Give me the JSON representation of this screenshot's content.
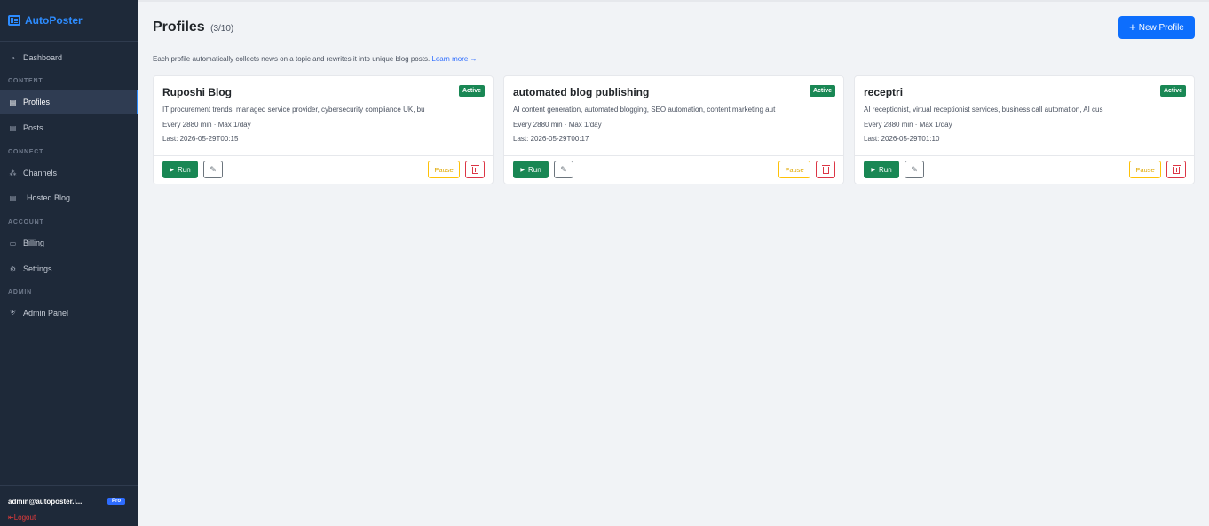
{
  "app": {
    "name": "AutoPoster"
  },
  "sidebar": {
    "items": [
      {
        "label": "Dashboard",
        "icon": "dashboard-icon"
      },
      {
        "label": "Profiles",
        "icon": "profiles-icon"
      },
      {
        "label": "Posts",
        "icon": "posts-icon"
      },
      {
        "label": "Channels",
        "icon": "channels-icon"
      },
      {
        "label": "Hosted Blog",
        "icon": "hosted-blog-icon"
      },
      {
        "label": "Billing",
        "icon": "billing-icon"
      },
      {
        "label": "Settings",
        "icon": "settings-icon"
      },
      {
        "label": "Admin Panel",
        "icon": "admin-icon"
      }
    ],
    "sections": {
      "content": "CONTENT",
      "connect": "CONNECT",
      "account": "ACCOUNT",
      "admin": "ADMIN"
    },
    "active_item": "Profiles",
    "user": {
      "email": "admin@autoposter.l...",
      "plan": "Pro",
      "logout_label": "Logout"
    }
  },
  "header": {
    "title": "Profiles",
    "count": "(3/10)",
    "new_button_label": "New Profile",
    "description": "Each profile automatically collects news on a topic and rewrites it into unique blog posts.",
    "learn_more": "Learn more →"
  },
  "profiles": [
    {
      "title": "Ruposhi Blog",
      "status": "Active",
      "keywords": "IT procurement trends, managed service provider, cybersecurity compliance UK, bu",
      "schedule": "Every 2880 min · Max 1/day",
      "last_run": "Last: 2026-05-29T00:15",
      "run_label": "Run",
      "pause_label": "Pause"
    },
    {
      "title": "automated blog publishing",
      "status": "Active",
      "keywords": "AI content generation, automated blogging, SEO automation, content marketing aut",
      "schedule": "Every 2880 min · Max 1/day",
      "last_run": "Last: 2026-05-29T00:17",
      "run_label": "Run",
      "pause_label": "Pause"
    },
    {
      "title": "receptri",
      "status": "Active",
      "keywords": "AI receptionist, virtual receptionist services, business call automation, AI cus",
      "schedule": "Every 2880 min · Max 1/day",
      "last_run": "Last: 2026-05-29T01:10",
      "run_label": "Run",
      "pause_label": "Pause"
    }
  ],
  "colors": {
    "sidebar_bg": "#1e2939",
    "brand": "#2d8cff",
    "primary": "#0d6efd",
    "success": "#198754",
    "warning": "#ffc107",
    "danger": "#dc3545"
  }
}
